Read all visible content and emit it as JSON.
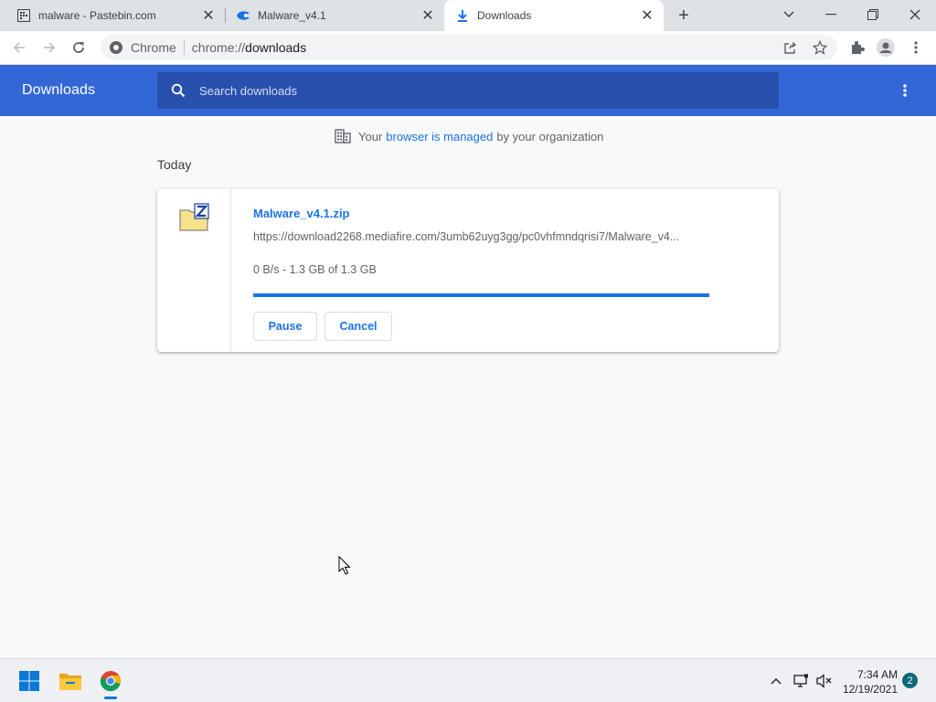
{
  "tabs": [
    {
      "title": "malware - Pastebin.com",
      "favicon": "pastebin-icon"
    },
    {
      "title": "Malware_v4.1",
      "favicon": "mediafire-icon"
    },
    {
      "title": "Downloads",
      "favicon": "download-icon",
      "active": true
    }
  ],
  "omnibox": {
    "chip": "Chrome",
    "url_scheme": "chrome://",
    "url_host": "downloads"
  },
  "downloads": {
    "title": "Downloads",
    "search_placeholder": "Search downloads",
    "managed": {
      "prefix": "Your",
      "link": "browser is managed",
      "suffix": "by your organization"
    },
    "section": "Today",
    "item": {
      "filename": "Malware_v4.1.zip",
      "url": "https://download2268.mediafire.com/3umb62uyg3gg/pc0vhfmndqrisi7/Malware_v4...",
      "progress_text": "0 B/s - 1.3 GB of 1.3 GB",
      "progress_fraction": 1.0,
      "pause_label": "Pause",
      "cancel_label": "Cancel"
    }
  },
  "taskbar": {
    "time": "7:34 AM",
    "date": "12/19/2021",
    "notification_count": "2"
  },
  "colors": {
    "header_blue": "#3367d6",
    "search_blue": "#2851ae",
    "link_blue": "#1a73e8"
  }
}
